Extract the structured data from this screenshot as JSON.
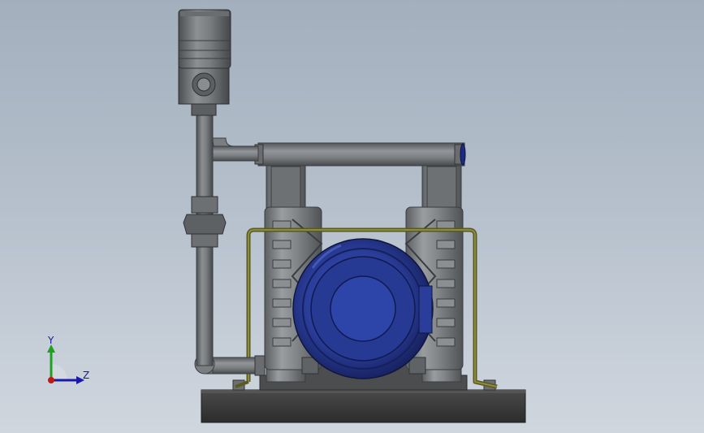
{
  "viewport": {
    "background_top": "#a3afbd",
    "background_bottom": "#cfd6de"
  },
  "model": {
    "components": [
      "top-valve-cylinder",
      "valve-body",
      "vertical-pipe",
      "pipe-union",
      "upper-manifold",
      "pump-chamber-left",
      "pump-chamber-right",
      "motor-housing",
      "frame-bracket",
      "base-plate"
    ],
    "colors": {
      "steel": "#7c7f82",
      "steel_dark": "#4a4d50",
      "steel_light": "#a8abae",
      "motor_blue": "#2a3d9a",
      "motor_blue_dark": "#1a2566",
      "frame_olive": "#6e6e2a",
      "base": "#3c3c3c"
    }
  },
  "triad": {
    "y_label": "Y",
    "z_label": "Z",
    "y_color": "#1fa11f",
    "z_color": "#1a1aa8",
    "x_color": "#c01818"
  }
}
